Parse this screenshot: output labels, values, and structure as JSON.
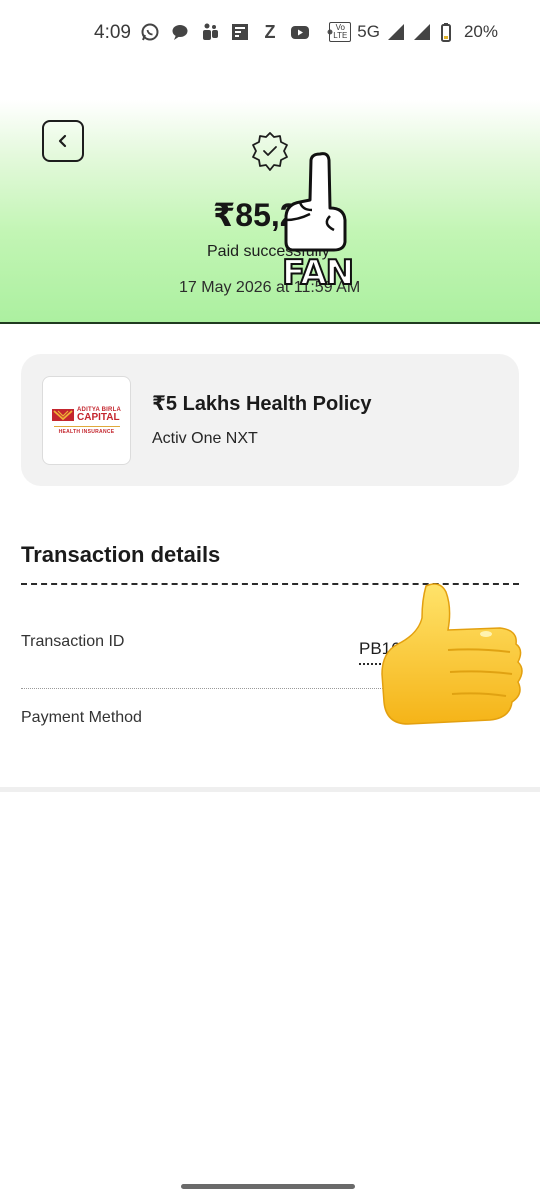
{
  "status_bar": {
    "time": "4:09",
    "network": "5G",
    "volte": "Vo LTE",
    "battery": "20%",
    "notification_icons": [
      "whatsapp-icon",
      "chat-bubble-icon",
      "teams-icon",
      "news-icon",
      "zomato-icon",
      "youtube-icon",
      "more-dot-icon"
    ]
  },
  "header": {
    "amount": "₹85,2",
    "status": "Paid successfully",
    "date": "17 May 2026 at 11:59 AM",
    "sticker_text": "FAN",
    "accent_color": "#acf0a0"
  },
  "policy": {
    "title": "₹5 Lakhs Health Policy",
    "plan": "Activ One NXT",
    "logo": {
      "line1": "ADITYA BIRLA",
      "line2": "CAPITAL",
      "line3": "HEALTH INSURANCE",
      "brand_color": "#c4262e"
    }
  },
  "transaction": {
    "heading": "Transaction details",
    "id_label": "Transaction ID",
    "id_value": "PB166",
    "payment_label": "Payment Method"
  }
}
